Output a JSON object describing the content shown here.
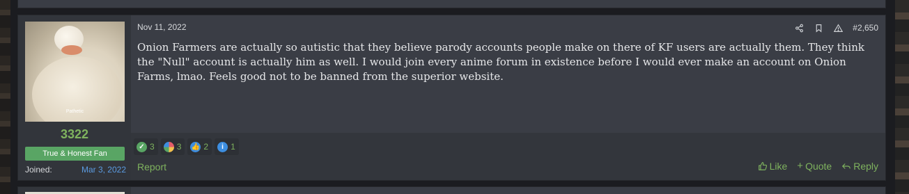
{
  "post": {
    "date": "Nov 11, 2022",
    "number": "#2,650",
    "body": "Onion Farmers are actually so autistic that they believe parody accounts people make on there of KF users are actually them. They think the \"Null\" account is actually him as well. I would join every anime forum in existence before I would ever make an account on Onion Farms, lmao. Feels good not to be banned from the superior website."
  },
  "user": {
    "name": "3322",
    "title": "True & Honest Fan",
    "joined_label": "Joined:",
    "joined_value": "Mar 3, 2022",
    "avatar_caption": "Pathetic"
  },
  "tools": [
    "share-icon",
    "bookmark-icon",
    "warning-icon"
  ],
  "reactions": [
    {
      "icon": "check-icon",
      "count": "3",
      "color": "#59a564"
    },
    {
      "icon": "pinwheel-icon",
      "count": "3",
      "color": "#d86fb0"
    },
    {
      "icon": "thumbs-up-icon",
      "count": "2",
      "color": "#3d8ee0"
    },
    {
      "icon": "info-icon",
      "count": "1",
      "color": "#3d8ee0"
    }
  ],
  "footer": {
    "report_label": "Report",
    "like_label": "Like",
    "quote_label": "Quote",
    "reply_label": "Reply"
  },
  "colors": {
    "accent": "#7fb35e",
    "link": "#5b9be1",
    "post_bg": "#3a3d45"
  }
}
